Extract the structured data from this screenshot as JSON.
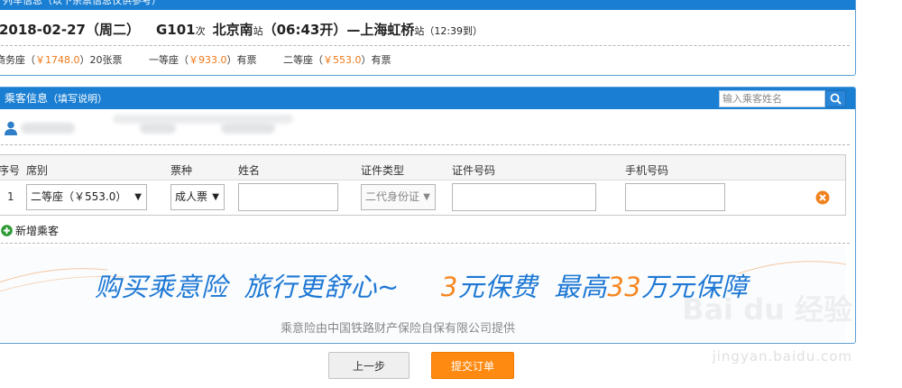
{
  "train_panel": {
    "header": "列车信息（以下余票信息仅供参考）",
    "date": "2018-02-27（周二）",
    "train_no": "G101",
    "train_suffix": "次",
    "from_station": "北京南",
    "from_suffix": "站",
    "depart": "（06:43开）",
    "separator": "—",
    "to_station": "上海虹桥",
    "to_suffix": "站",
    "arrive": "（12:39到）",
    "seats": [
      {
        "label": "商务座（",
        "price": "￥1748.0",
        "rest": "）20张票"
      },
      {
        "label": "一等座（",
        "price": "￥933.0",
        "rest": "）有票"
      },
      {
        "label": "二等座（",
        "price": "￥553.0",
        "rest": "）有票"
      }
    ]
  },
  "passenger_panel": {
    "header": "乘客信息",
    "header_note": "（填写说明）",
    "search_placeholder": "输入乘客姓名",
    "columns": {
      "no": "序号",
      "seat": "席别",
      "ticket_type": "票种",
      "name": "姓名",
      "id_type": "证件类型",
      "id_number": "证件号码",
      "phone": "手机号码"
    },
    "row": {
      "no": "1",
      "seat": "二等座（￥553.0）",
      "ticket_type": "成人票",
      "name": "",
      "id_type": "二代身份证",
      "id_number": "",
      "phone": ""
    },
    "add_passenger": "新增乘客"
  },
  "insurance_banner": {
    "part1": "购买乘意险",
    "part2": "旅行更舒心~",
    "num1": "3",
    "part3": "元保费",
    "part4": "最高",
    "num2": "33",
    "part5": "万元保障",
    "provider": "乘意险由中国铁路财产保险自保有限公司提供"
  },
  "buttons": {
    "prev": "上一步",
    "submit": "提交订单"
  },
  "watermark": {
    "logo": "Bai du 经验",
    "url": "jingyan.baidu.com"
  },
  "colors": {
    "header_blue": "#1a7fd3",
    "price_orange": "#f07818",
    "submit_orange": "#ff8a12",
    "banner_blue": "#1e78d4"
  }
}
